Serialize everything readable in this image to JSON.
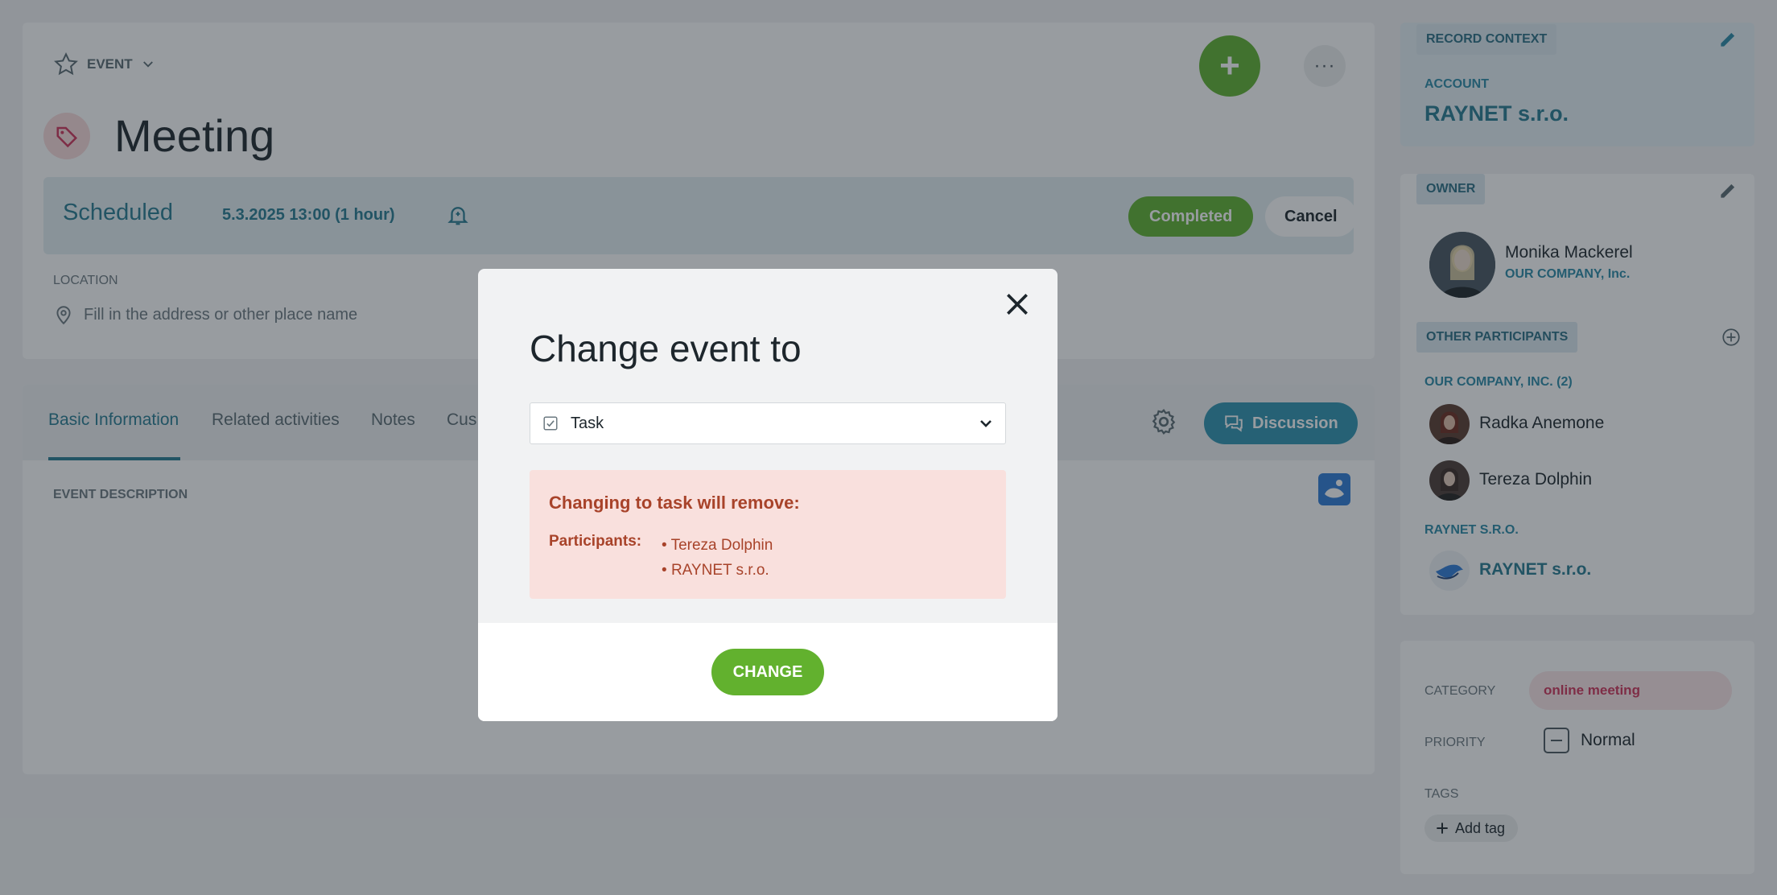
{
  "header": {
    "event_type_label": "EVENT",
    "title": "Meeting",
    "status": "Scheduled",
    "datetime": "5.3.2025 13:00 (1 hour)",
    "completed_label": "Completed",
    "cancel_label": "Cancel",
    "add_label": "+",
    "more_label": "···",
    "location_label": "LOCATION",
    "location_placeholder": "Fill in the address or other place name"
  },
  "tabs": {
    "items": [
      {
        "label": "Basic Information"
      },
      {
        "label": "Related activities"
      },
      {
        "label": "Notes"
      },
      {
        "label": "Cus"
      }
    ],
    "discussion_label": "Discussion",
    "description_label": "EVENT DESCRIPTION"
  },
  "sidebar": {
    "record_context_label": "RECORD CONTEXT",
    "account_label": "ACCOUNT",
    "account_name": "RAYNET s.r.o.",
    "owner_label": "OWNER",
    "owner_name": "Monika Mackerel",
    "owner_company": "OUR COMPANY, Inc.",
    "other_participants_label": "OTHER PARTICIPANTS",
    "groups": [
      {
        "label": "OUR COMPANY, INC. (2)",
        "people": [
          "Radka Anemone",
          "Tereza Dolphin"
        ]
      },
      {
        "label": "RAYNET S.R.O.",
        "people": [
          "RAYNET s.r.o."
        ]
      }
    ],
    "category_label": "CATEGORY",
    "category_value": "online meeting",
    "priority_label": "PRIORITY",
    "priority_value": "Normal",
    "tags_label": "TAGS",
    "add_tag_label": "Add tag"
  },
  "modal": {
    "title": "Change event to",
    "selected_type": "Task",
    "warning_title": "Changing to task will remove:",
    "participants_label": "Participants:",
    "removed_participants": [
      "Tereza Dolphin",
      "RAYNET s.r.o."
    ],
    "change_label": "CHANGE"
  },
  "colors": {
    "accent": "#267a91",
    "primary_green": "#5fb12f",
    "warning_bg": "#f9e0dd",
    "warning_text": "#a8432a",
    "discussion": "#2e93b0",
    "category_text": "#d0335a"
  }
}
